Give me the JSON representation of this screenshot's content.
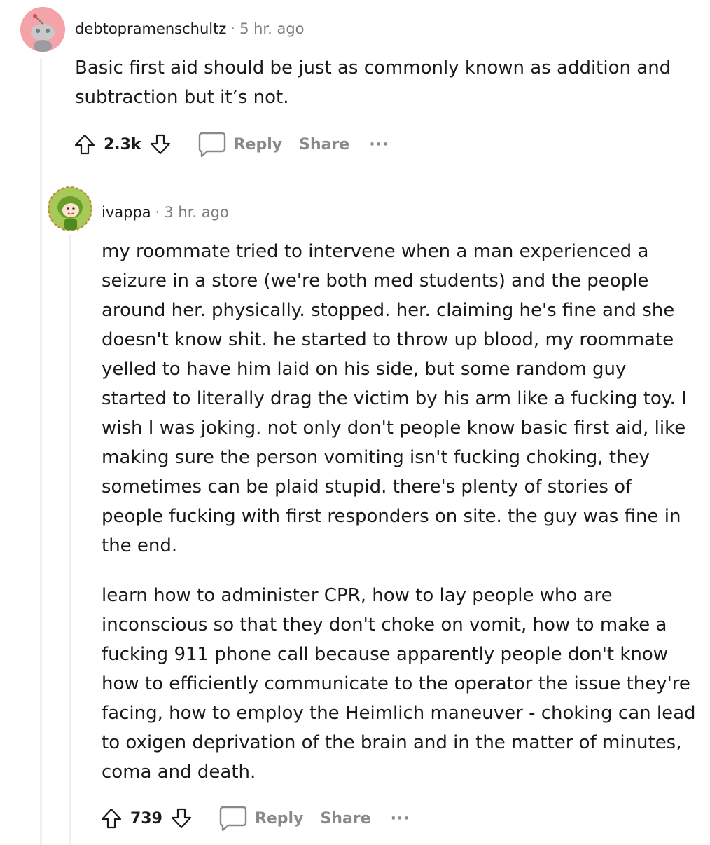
{
  "comments": [
    {
      "author": "debtopramenschultz",
      "separator": "·",
      "time": "5 hr. ago",
      "paragraphs": [
        "Basic first aid should be just as commonly known as addition and subtraction but it’s not."
      ],
      "votes": "2.3k",
      "reply_label": "Reply",
      "share_label": "Share",
      "more_label": "···"
    },
    {
      "author": "ivappa",
      "separator": "·",
      "time": "3 hr. ago",
      "paragraphs": [
        "my roommate tried to intervene when a man experienced a seizure in a store (we're both med students) and the people around her. physically. stopped. her. claiming he's fine and she doesn't know shit. he started to throw up blood, my roommate yelled to have him laid on his side, but some random guy started to literally drag the victim by his arm like a fucking toy. I wish I was joking. not only don't people know basic first aid, like making sure the person vomiting isn't fucking choking, they sometimes can be plaid stupid. there's plenty of stories of people fucking with first responders on site. the guy was fine in the end.",
        "learn how to administer CPR, how to lay people who are inconscious so that they don't choke on vomit, how to make a fucking 911 phone call because apparently people don't know how to efficiently communicate to the operator the issue they're facing, how to employ the Heimlich maneuver - choking can lead to oxigen deprivation of the brain and in the matter of minutes, coma and death."
      ],
      "votes": "739",
      "reply_label": "Reply",
      "share_label": "Share",
      "more_label": "···"
    }
  ],
  "colors": {
    "avatar1_bg": "#f4a3a8",
    "avatar2_bg": "#8fbc3f",
    "muted": "#878a8c",
    "thread_line": "#edeff1"
  },
  "icons": {
    "upvote": "upvote-arrow-icon",
    "downvote": "downvote-arrow-icon",
    "reply": "speech-bubble-icon"
  }
}
